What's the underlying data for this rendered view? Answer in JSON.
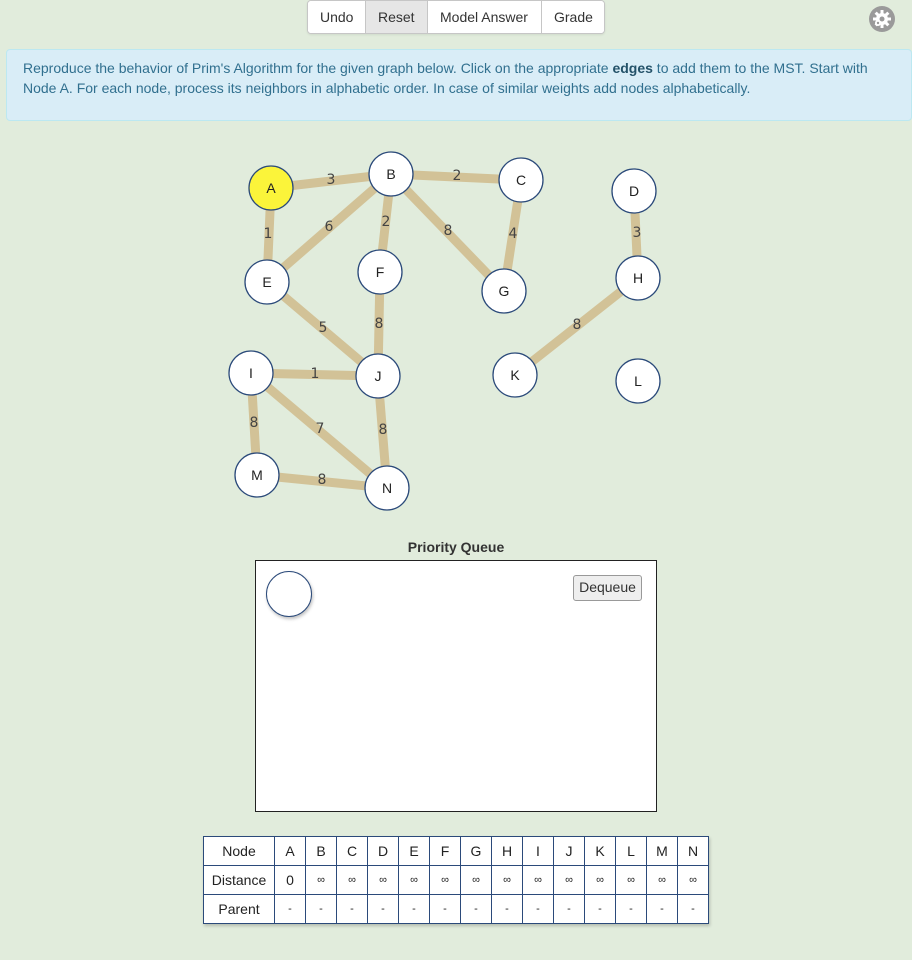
{
  "toolbar": {
    "undo": "Undo",
    "reset": "Reset",
    "model_answer": "Model Answer",
    "grade": "Grade"
  },
  "settings_icon": "gear-icon",
  "instructions": {
    "part1": "Reproduce the behavior of Prim's Algorithm for the given graph below. Click on the appropriate ",
    "bold": "edges",
    "part2": " to add them to the MST. Start with Node A. For each node, process its neighbors in alphabetic order. In case of similar weights add nodes alphabetically."
  },
  "colors": {
    "background": "#e1ecdc",
    "edge": "#d2c297",
    "current_node": "#fbf43a",
    "node_border": "#2b4a7a",
    "info_bg": "#d9edf7",
    "info_text": "#31708f"
  },
  "graph": {
    "current_node": "A",
    "nodes": [
      "A",
      "B",
      "C",
      "D",
      "E",
      "F",
      "G",
      "H",
      "I",
      "J",
      "K",
      "L",
      "M",
      "N"
    ],
    "edges": [
      {
        "from": "A",
        "to": "B",
        "weight": "3"
      },
      {
        "from": "A",
        "to": "E",
        "weight": "1"
      },
      {
        "from": "B",
        "to": "C",
        "weight": "2"
      },
      {
        "from": "B",
        "to": "E",
        "weight": "6"
      },
      {
        "from": "B",
        "to": "F",
        "weight": "2"
      },
      {
        "from": "B",
        "to": "G",
        "weight": "8"
      },
      {
        "from": "C",
        "to": "G",
        "weight": "4"
      },
      {
        "from": "D",
        "to": "H",
        "weight": "3"
      },
      {
        "from": "E",
        "to": "J",
        "weight": "5"
      },
      {
        "from": "F",
        "to": "J",
        "weight": "8"
      },
      {
        "from": "H",
        "to": "K",
        "weight": "8"
      },
      {
        "from": "I",
        "to": "J",
        "weight": "1"
      },
      {
        "from": "I",
        "to": "M",
        "weight": "8"
      },
      {
        "from": "I",
        "to": "N",
        "weight": "7"
      },
      {
        "from": "J",
        "to": "N",
        "weight": "8"
      },
      {
        "from": "M",
        "to": "N",
        "weight": "8"
      }
    ]
  },
  "priority_queue": {
    "title": "Priority Queue",
    "dequeue_label": "Dequeue"
  },
  "table": {
    "row_labels": [
      "Node",
      "Distance",
      "Parent"
    ],
    "nodes": [
      "A",
      "B",
      "C",
      "D",
      "E",
      "F",
      "G",
      "H",
      "I",
      "J",
      "K",
      "L",
      "M",
      "N"
    ],
    "distance": [
      "0",
      "∞",
      "∞",
      "∞",
      "∞",
      "∞",
      "∞",
      "∞",
      "∞",
      "∞",
      "∞",
      "∞",
      "∞",
      "∞"
    ],
    "parent": [
      "-",
      "-",
      "-",
      "-",
      "-",
      "-",
      "-",
      "-",
      "-",
      "-",
      "-",
      "-",
      "-",
      "-"
    ]
  }
}
